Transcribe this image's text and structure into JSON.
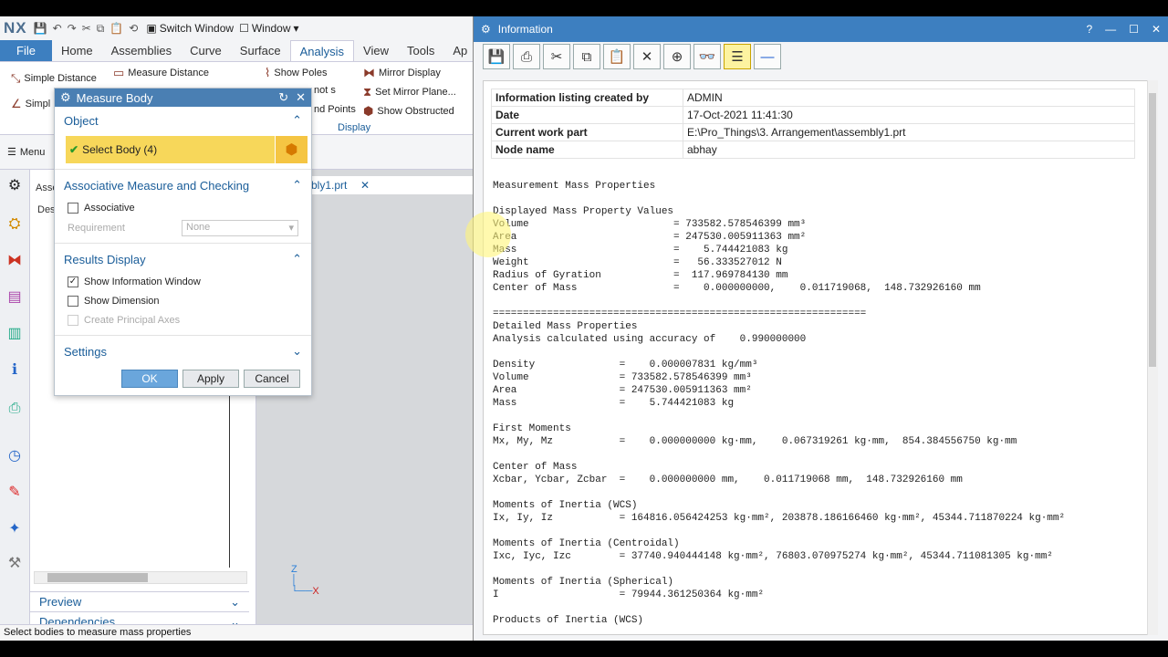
{
  "quick_access": {
    "logo": "NX",
    "switch_window": "Switch Window",
    "window": "Window"
  },
  "ribbon": {
    "tabs": [
      "File",
      "Home",
      "Assemblies",
      "Curve",
      "Surface",
      "Analysis",
      "View",
      "Tools",
      "Ap"
    ],
    "buttons": {
      "simple_distance": "Simple Distance",
      "measure_distance": "Measure Distance",
      "simple_short": "Simpl",
      "show_poles": "Show Poles",
      "knots": "not s",
      "end_points": "nd Points",
      "mirror_display": "Mirror Display",
      "set_mirror_plane": "Set Mirror Plane...",
      "show_obstructed": "Show Obstructed"
    },
    "display_group": "Display"
  },
  "menu": "Menu",
  "nav": {
    "header": "Asse",
    "col": "Des",
    "preview": "Preview",
    "dependencies": "Dependencies"
  },
  "part_tab": "bly1.prt",
  "status": "Select bodies to measure mass properties",
  "measure_body": {
    "title": "Measure Body",
    "object_section": "Object",
    "select_body": "Select Body (4)",
    "assoc_section": "Associative Measure and Checking",
    "associative": "Associative",
    "requirement_label": "Requirement",
    "requirement_value": "None",
    "results_section": "Results Display",
    "show_info": "Show Information Window",
    "show_dimension": "Show Dimension",
    "principal_axes": "Create Principal Axes",
    "settings_section": "Settings",
    "ok": "OK",
    "apply": "Apply",
    "cancel": "Cancel"
  },
  "info": {
    "title": "Information",
    "header_rows": [
      {
        "k": "Information listing created by",
        "v": "ADMIN"
      },
      {
        "k": "Date",
        "v": "17-Oct-2021 11:41:30"
      },
      {
        "k": "Current work part",
        "v": "E:\\Pro_Things\\3. Arrangement\\assembly1.prt"
      },
      {
        "k": "Node name",
        "v": "abhay"
      }
    ],
    "body": "Measurement Mass Properties\n\nDisplayed Mass Property Values\nVolume                        = 733582.578546399 mm³\nArea                          = 247530.005911363 mm²\nMass                          =    5.744421083 kg\nWeight                        =   56.333527012 N\nRadius of Gyration            =  117.969784130 mm\nCenter of Mass                =    0.000000000,    0.011719068,  148.732926160 mm\n\n==============================================================\nDetailed Mass Properties\nAnalysis calculated using accuracy of    0.990000000\n\nDensity              =    0.000007831 kg/mm³\nVolume               = 733582.578546399 mm³\nArea                 = 247530.005911363 mm²\nMass                 =    5.744421083 kg\n\nFirst Moments\nMx, My, Mz           =    0.000000000 kg·mm,    0.067319261 kg·mm,  854.384556750 kg·mm\n\nCenter of Mass\nXcbar, Ycbar, Zcbar  =    0.000000000 mm,    0.011719068 mm,  148.732926160 mm\n\nMoments of Inertia (WCS)\nIx, Iy, Iz           = 164816.056424253 kg·mm², 203878.186166460 kg·mm², 45344.711870224 kg·mm²\n\nMoments of Inertia (Centroidal)\nIxc, Iyc, Izc        = 37740.940444148 kg·mm², 76803.070975274 kg·mm², 45344.711081305 kg·mm²\n\nMoments of Inertia (Spherical)\nI                    = 79944.361250364 kg·mm²\n\nProducts of Inertia (WCS)"
  }
}
